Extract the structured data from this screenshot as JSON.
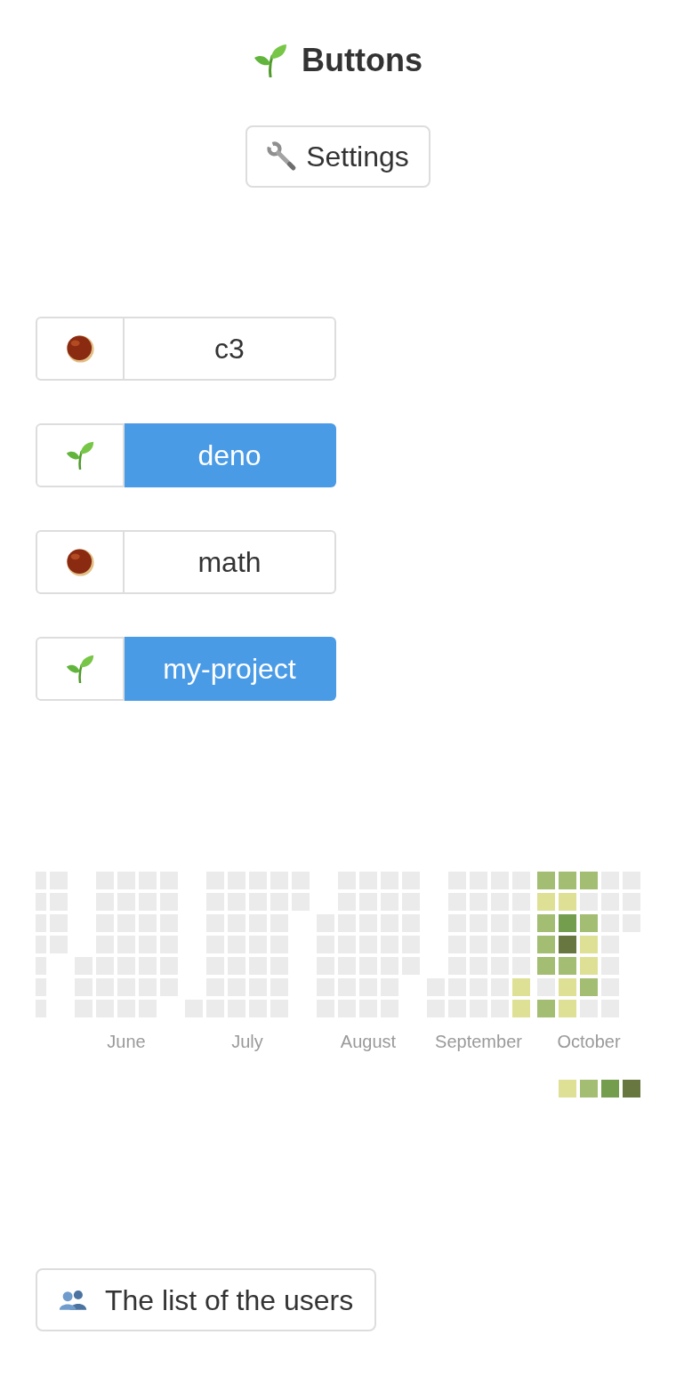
{
  "header": {
    "title": "Buttons"
  },
  "settings_button": {
    "label": "Settings"
  },
  "projects": [
    {
      "name": "c3",
      "selected": false
    },
    {
      "name": "deno",
      "selected": true
    },
    {
      "name": "math",
      "selected": false
    },
    {
      "name": "my-project",
      "selected": true
    }
  ],
  "activity": {
    "months": [
      {
        "weeks": [
          {
            "days": [
              {
                "color": "#ebebeb"
              },
              {
                "color": "#ebebeb"
              },
              {
                "color": "#ebebeb"
              },
              {
                "color": "#ebebeb"
              },
              {
                "color": "#ebebeb"
              },
              {
                "color": "#ebebeb"
              },
              {
                "color": "#ebebeb"
              }
            ]
          },
          {
            "days": [
              {
                "color": "#ebebeb"
              },
              {
                "color": "#ebebeb"
              },
              {
                "color": "#ebebeb"
              },
              {
                "color": "#ebebeb"
              }
            ]
          }
        ]
      },
      {
        "label": "June",
        "weeks": [
          {
            "days": [
              {
                "color": "#ebebeb"
              },
              {
                "color": "#ebebeb"
              },
              {
                "color": "#ebebeb"
              }
            ]
          },
          {
            "days": [
              {
                "color": "#ebebeb"
              },
              {
                "color": "#ebebeb"
              },
              {
                "color": "#ebebeb"
              },
              {
                "color": "#ebebeb"
              },
              {
                "color": "#ebebeb"
              },
              {
                "color": "#ebebeb"
              },
              {
                "color": "#ebebeb"
              }
            ]
          },
          {
            "days": [
              {
                "color": "#ebebeb"
              },
              {
                "color": "#ebebeb"
              },
              {
                "color": "#ebebeb"
              },
              {
                "color": "#ebebeb"
              },
              {
                "color": "#ebebeb"
              },
              {
                "color": "#ebebeb"
              },
              {
                "color": "#ebebeb"
              }
            ]
          },
          {
            "days": [
              {
                "color": "#ebebeb"
              },
              {
                "color": "#ebebeb"
              },
              {
                "color": "#ebebeb"
              },
              {
                "color": "#ebebeb"
              },
              {
                "color": "#ebebeb"
              },
              {
                "color": "#ebebeb"
              },
              {
                "color": "#ebebeb"
              }
            ]
          },
          {
            "days": [
              {
                "color": "#ebebeb"
              },
              {
                "color": "#ebebeb"
              },
              {
                "color": "#ebebeb"
              },
              {
                "color": "#ebebeb"
              },
              {
                "color": "#ebebeb"
              },
              {
                "color": "#ebebeb"
              }
            ]
          }
        ]
      },
      {
        "label": "July",
        "weeks": [
          {
            "days": [
              {
                "color": "#ebebeb"
              }
            ]
          },
          {
            "days": [
              {
                "color": "#ebebeb"
              },
              {
                "color": "#ebebeb"
              },
              {
                "color": "#ebebeb"
              },
              {
                "color": "#ebebeb"
              },
              {
                "color": "#ebebeb"
              },
              {
                "color": "#ebebeb"
              },
              {
                "color": "#ebebeb"
              }
            ]
          },
          {
            "days": [
              {
                "color": "#ebebeb"
              },
              {
                "color": "#ebebeb"
              },
              {
                "color": "#ebebeb"
              },
              {
                "color": "#ebebeb"
              },
              {
                "color": "#ebebeb"
              },
              {
                "color": "#ebebeb"
              },
              {
                "color": "#ebebeb"
              }
            ]
          },
          {
            "days": [
              {
                "color": "#ebebeb"
              },
              {
                "color": "#ebebeb"
              },
              {
                "color": "#ebebeb"
              },
              {
                "color": "#ebebeb"
              },
              {
                "color": "#ebebeb"
              },
              {
                "color": "#ebebeb"
              },
              {
                "color": "#ebebeb"
              }
            ]
          },
          {
            "days": [
              {
                "color": "#ebebeb"
              },
              {
                "color": "#ebebeb"
              },
              {
                "color": "#ebebeb"
              },
              {
                "color": "#ebebeb"
              },
              {
                "color": "#ebebeb"
              },
              {
                "color": "#ebebeb"
              },
              {
                "color": "#ebebeb"
              }
            ]
          },
          {
            "days": [
              {
                "color": "#ebebeb"
              },
              {
                "color": "#ebebeb"
              }
            ]
          }
        ]
      },
      {
        "label": "August",
        "weeks": [
          {
            "days": [
              {
                "color": "#ebebeb"
              },
              {
                "color": "#ebebeb"
              },
              {
                "color": "#ebebeb"
              },
              {
                "color": "#ebebeb"
              },
              {
                "color": "#ebebeb"
              }
            ]
          },
          {
            "days": [
              {
                "color": "#ebebeb"
              },
              {
                "color": "#ebebeb"
              },
              {
                "color": "#ebebeb"
              },
              {
                "color": "#ebebeb"
              },
              {
                "color": "#ebebeb"
              },
              {
                "color": "#ebebeb"
              },
              {
                "color": "#ebebeb"
              }
            ]
          },
          {
            "days": [
              {
                "color": "#ebebeb"
              },
              {
                "color": "#ebebeb"
              },
              {
                "color": "#ebebeb"
              },
              {
                "color": "#ebebeb"
              },
              {
                "color": "#ebebeb"
              },
              {
                "color": "#ebebeb"
              },
              {
                "color": "#ebebeb"
              }
            ]
          },
          {
            "days": [
              {
                "color": "#ebebeb"
              },
              {
                "color": "#ebebeb"
              },
              {
                "color": "#ebebeb"
              },
              {
                "color": "#ebebeb"
              },
              {
                "color": "#ebebeb"
              },
              {
                "color": "#ebebeb"
              },
              {
                "color": "#ebebeb"
              }
            ]
          },
          {
            "days": [
              {
                "color": "#ebebeb"
              },
              {
                "color": "#ebebeb"
              },
              {
                "color": "#ebebeb"
              },
              {
                "color": "#ebebeb"
              },
              {
                "color": "#ebebeb"
              }
            ]
          }
        ]
      },
      {
        "label": "September",
        "weeks": [
          {
            "days": [
              {
                "color": "#ebebeb"
              },
              {
                "color": "#ebebeb"
              }
            ]
          },
          {
            "days": [
              {
                "color": "#ebebeb"
              },
              {
                "color": "#ebebeb"
              },
              {
                "color": "#ebebeb"
              },
              {
                "color": "#ebebeb"
              },
              {
                "color": "#ebebeb"
              },
              {
                "color": "#ebebeb"
              },
              {
                "color": "#ebebeb"
              }
            ]
          },
          {
            "days": [
              {
                "color": "#ebebeb"
              },
              {
                "color": "#ebebeb"
              },
              {
                "color": "#ebebeb"
              },
              {
                "color": "#ebebeb"
              },
              {
                "color": "#ebebeb"
              },
              {
                "color": "#ebebeb"
              },
              {
                "color": "#ebebeb"
              }
            ]
          },
          {
            "days": [
              {
                "color": "#ebebeb"
              },
              {
                "color": "#ebebeb"
              },
              {
                "color": "#ebebeb"
              },
              {
                "color": "#ebebeb"
              },
              {
                "color": "#ebebeb"
              },
              {
                "color": "#ebebeb"
              },
              {
                "color": "#ebebeb"
              }
            ]
          },
          {
            "days": [
              {
                "color": "#ebebeb"
              },
              {
                "color": "#ebebeb"
              },
              {
                "color": "#ebebeb"
              },
              {
                "color": "#ebebeb"
              },
              {
                "color": "#ebebeb"
              },
              {
                "color": "#dee195"
              },
              {
                "color": "#dee195"
              }
            ]
          }
        ]
      },
      {
        "label": "October",
        "weeks": [
          {
            "days": [
              {
                "color": "#a3bd72"
              },
              {
                "color": "#dee195"
              },
              {
                "color": "#a3bd72"
              },
              {
                "color": "#a3bd72"
              },
              {
                "color": "#a3bd72"
              },
              {
                "color": "#ebebeb"
              },
              {
                "color": "#a3bd72"
              }
            ]
          },
          {
            "days": [
              {
                "color": "#a3bd72"
              },
              {
                "color": "#dee195"
              },
              {
                "color": "#749d4e"
              },
              {
                "color": "#67773f"
              },
              {
                "color": "#a3bd72"
              },
              {
                "color": "#dee195"
              },
              {
                "color": "#dee195"
              }
            ]
          },
          {
            "days": [
              {
                "color": "#a3bd72"
              },
              {
                "color": "#ebebeb"
              },
              {
                "color": "#a3bd72"
              },
              {
                "color": "#dee195"
              },
              {
                "color": "#dee195"
              },
              {
                "color": "#a3bd72"
              },
              {
                "color": "#ebebeb"
              }
            ]
          },
          {
            "days": [
              {
                "color": "#ebebeb"
              },
              {
                "color": "#ebebeb"
              },
              {
                "color": "#ebebeb"
              },
              {
                "color": "#ebebeb"
              },
              {
                "color": "#ebebeb"
              },
              {
                "color": "#ebebeb"
              },
              {
                "color": "#ebebeb"
              }
            ]
          },
          {
            "days": [
              {
                "color": "#ebebeb"
              },
              {
                "color": "#ebebeb"
              },
              {
                "color": "#ebebeb"
              }
            ]
          }
        ]
      }
    ],
    "legend": [
      {
        "color": "#dee195"
      },
      {
        "color": "#a3bd72"
      },
      {
        "color": "#749d4e"
      },
      {
        "color": "#67773f"
      }
    ]
  },
  "users_button": {
    "label": "The list of the users"
  }
}
